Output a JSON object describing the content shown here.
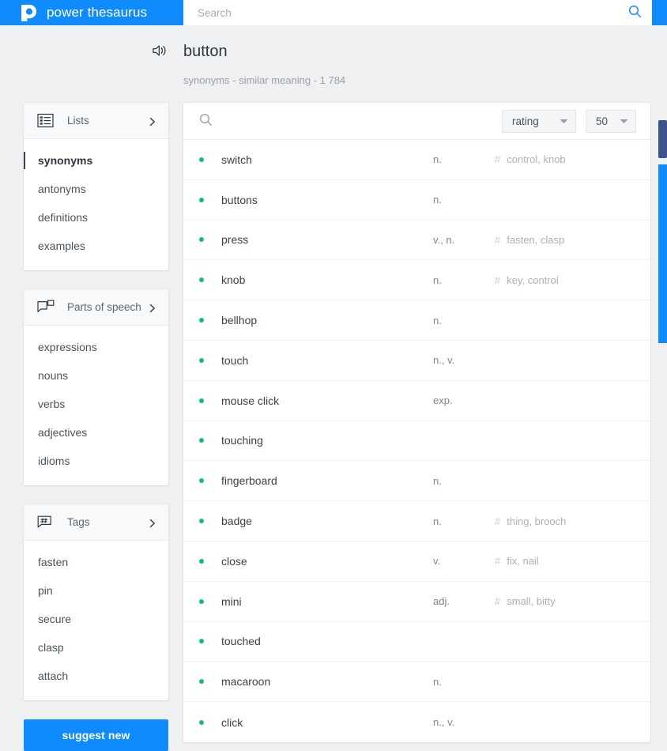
{
  "brand": {
    "name": "power thesaurus",
    "logo_icon": "power-thesaurus-logo"
  },
  "search": {
    "placeholder": "Search",
    "value": "",
    "icon": "search-icon"
  },
  "header": {
    "title": "button",
    "subtitle": "synonyms - similar meaning - 1 784",
    "pronounce_icon": "speaker-icon"
  },
  "sidebar": {
    "sections": [
      {
        "title": "Lists",
        "icon": "list-icon",
        "expand_icon": "chevron-right-icon",
        "items": [
          {
            "label": "synonyms",
            "active": true
          },
          {
            "label": "antonyms",
            "active": false
          },
          {
            "label": "definitions",
            "active": false
          },
          {
            "label": "examples",
            "active": false
          }
        ]
      },
      {
        "title": "Parts of speech",
        "icon": "speech-bubble-icon",
        "expand_icon": "chevron-right-icon",
        "items": [
          {
            "label": "expressions",
            "active": false
          },
          {
            "label": "nouns",
            "active": false
          },
          {
            "label": "verbs",
            "active": false
          },
          {
            "label": "adjectives",
            "active": false
          },
          {
            "label": "idioms",
            "active": false
          }
        ]
      },
      {
        "title": "Tags",
        "icon": "hashtag-bubble-icon",
        "expand_icon": "chevron-right-icon",
        "items": [
          {
            "label": "fasten",
            "active": false
          },
          {
            "label": "pin",
            "active": false
          },
          {
            "label": "secure",
            "active": false
          },
          {
            "label": "clasp",
            "active": false
          },
          {
            "label": "attach",
            "active": false
          }
        ]
      }
    ],
    "suggest_button": "suggest new"
  },
  "results": {
    "toolbar": {
      "filter_icon": "search-icon",
      "sort_select": {
        "value": "rating",
        "caret_icon": "caret-down-icon"
      },
      "count_select": {
        "value": "50",
        "caret_icon": "caret-down-icon"
      }
    },
    "tag_prefix": "#",
    "rows": [
      {
        "term": "switch",
        "pos": "n.",
        "tags": "control, knob"
      },
      {
        "term": "buttons",
        "pos": "n.",
        "tags": ""
      },
      {
        "term": "press",
        "pos": "v., n.",
        "tags": "fasten, clasp"
      },
      {
        "term": "knob",
        "pos": "n.",
        "tags": "key, control"
      },
      {
        "term": "bellhop",
        "pos": "n.",
        "tags": ""
      },
      {
        "term": "touch",
        "pos": "n., v.",
        "tags": ""
      },
      {
        "term": "mouse click",
        "pos": "exp.",
        "tags": ""
      },
      {
        "term": "touching",
        "pos": "",
        "tags": ""
      },
      {
        "term": "fingerboard",
        "pos": "n.",
        "tags": ""
      },
      {
        "term": "badge",
        "pos": "n.",
        "tags": "thing, brooch"
      },
      {
        "term": "close",
        "pos": "v.",
        "tags": "fix, nail"
      },
      {
        "term": "mini",
        "pos": "adj.",
        "tags": "small, bitty"
      },
      {
        "term": "touched",
        "pos": "",
        "tags": ""
      },
      {
        "term": "macaroon",
        "pos": "n.",
        "tags": ""
      },
      {
        "term": "click",
        "pos": "n., v.",
        "tags": ""
      }
    ]
  },
  "colors": {
    "brand_blue": "#0f8bfd",
    "bullet_green": "#11bf78",
    "page_background": "#eef0f2",
    "scrollbar_thumb": "#3c5488"
  }
}
